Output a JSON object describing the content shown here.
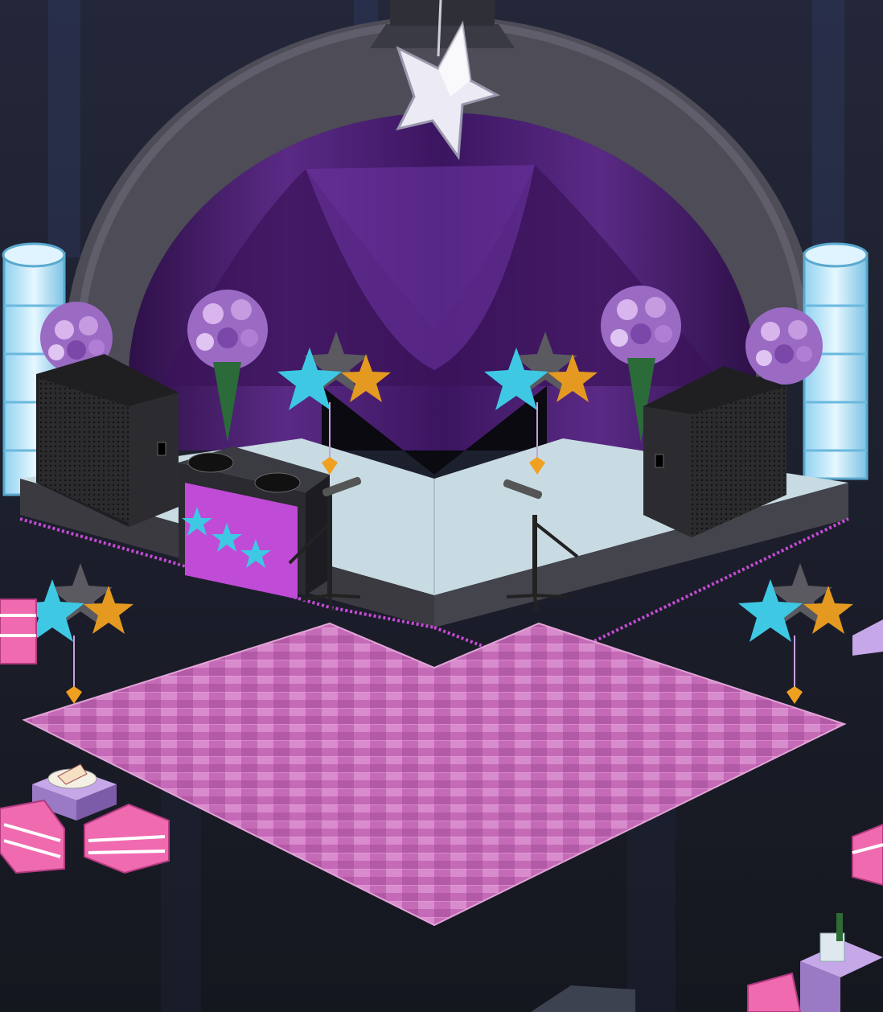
{
  "room": {
    "title": "",
    "background_color": "#1a1d2b",
    "stage_floor_color": "#c9dbe2",
    "curtain_color": "#4a1f6e",
    "arch_color": "#4a4a55",
    "dance_floor_color": "#c86ab8",
    "led_strip_color": "#c84ad8",
    "pillar_light_color": "#bfe8fb"
  },
  "furniture": [
    {
      "name": "star-ornament",
      "label": ""
    },
    {
      "name": "speaker-left",
      "brand": ""
    },
    {
      "name": "speaker-right",
      "brand": ""
    },
    {
      "name": "dj-booth",
      "label": ""
    },
    {
      "name": "microphone-stand-left",
      "label": ""
    },
    {
      "name": "microphone-stand-right",
      "label": ""
    },
    {
      "name": "balloon-bundle",
      "count": 4
    },
    {
      "name": "flower-bouquet",
      "count": 4
    },
    {
      "name": "ice-pillar",
      "count": 2
    },
    {
      "name": "striped-sofa",
      "count": 3
    },
    {
      "name": "cake-table",
      "label": ""
    },
    {
      "name": "champagne-table",
      "label": ""
    }
  ],
  "balloon_colors": [
    "#3ec8e4",
    "#5a5a60",
    "#e49a20"
  ]
}
